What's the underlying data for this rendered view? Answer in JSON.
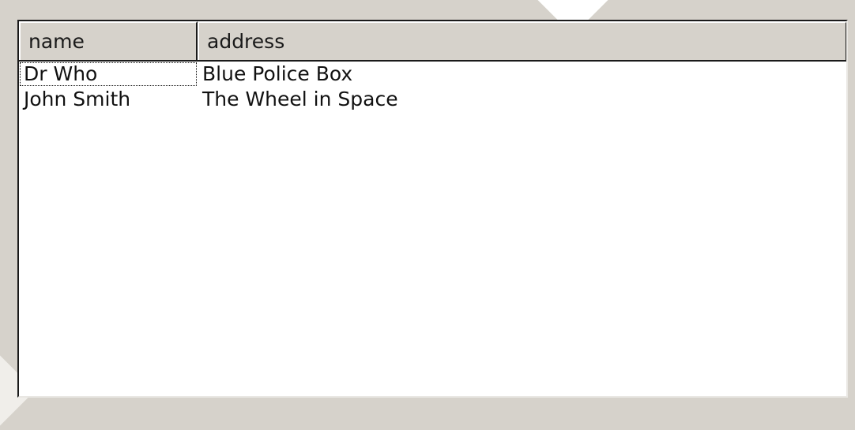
{
  "table": {
    "columns": [
      "name",
      "address"
    ],
    "rows": [
      {
        "name": "Dr Who",
        "address": "Blue Police Box"
      },
      {
        "name": "John Smith",
        "address": "The Wheel in Space"
      }
    ],
    "focused_cell": {
      "row": 0,
      "column": "name"
    }
  },
  "colors": {
    "window_background": "#d6d2cb",
    "table_background": "#ffffff",
    "text": "#111111"
  }
}
